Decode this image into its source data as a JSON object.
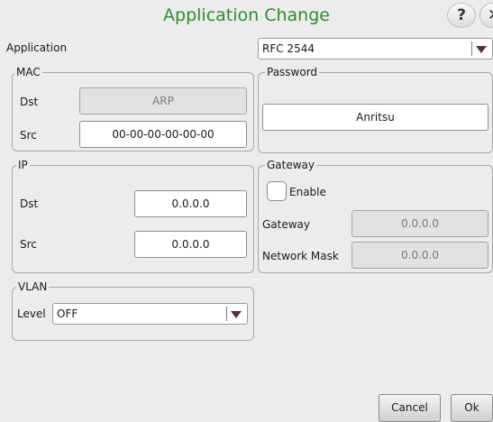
{
  "window": {
    "title": "Application Change",
    "help_glyph": "?",
    "close_glyph": "✕"
  },
  "application": {
    "label": "Application",
    "selected": "RFC 2544"
  },
  "mac": {
    "legend": "MAC",
    "dst_label": "Dst",
    "dst_value": "ARP",
    "src_label": "Src",
    "src_value": "00-00-00-00-00-00"
  },
  "password": {
    "legend": "Password",
    "value": "Anritsu"
  },
  "ip": {
    "legend": "IP",
    "dst_label": "Dst",
    "dst_value": "0.0.0.0",
    "src_label": "Src",
    "src_value": "0.0.0.0"
  },
  "gateway": {
    "legend": "Gateway",
    "enable_label": "Enable",
    "gateway_label": "Gateway",
    "gateway_value": "0.0.0.0",
    "mask_label": "Network Mask",
    "mask_value": "0.0.0.0"
  },
  "vlan": {
    "legend": "VLAN",
    "level_label": "Level",
    "level_selected": "OFF"
  },
  "footer": {
    "cancel_label": "Cancel",
    "ok_label": "Ok"
  },
  "colors": {
    "title": "#2e8b2e",
    "background": "#ececec",
    "arrow": "#5a3030"
  },
  "icons": {
    "help": "help-icon",
    "close": "close-icon",
    "dropdown": "triangle-down-icon"
  }
}
